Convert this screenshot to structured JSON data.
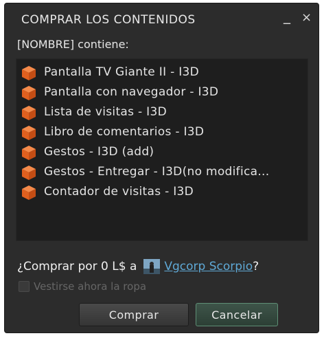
{
  "window": {
    "title": "COMPRAR LOS CONTENIDOS",
    "minimize_glyph": "_",
    "close_glyph": "×"
  },
  "contains_label": "[NOMBRE] contiene:",
  "items": [
    {
      "label": "Pantalla TV Giante II - I3D",
      "icon": "object-cube-icon"
    },
    {
      "label": "Pantalla con navegador - I3D",
      "icon": "object-cube-icon"
    },
    {
      "label": "Lista de visitas - I3D",
      "icon": "object-cube-icon"
    },
    {
      "label": "Libro de comentarios - I3D",
      "icon": "object-cube-icon"
    },
    {
      "label": "Gestos - I3D (add)",
      "icon": "object-cube-icon"
    },
    {
      "label": "Gestos - Entregar  - I3D(no modifica...",
      "icon": "object-cube-icon"
    },
    {
      "label": "Contador de visitas - I3D",
      "icon": "object-cube-icon"
    }
  ],
  "buy_prompt": {
    "prefix": "¿Comprar por 0 L$ a",
    "owner": "Vgcorp Scorpio",
    "suffix": "?"
  },
  "wear_checkbox": {
    "label": "Vestirse ahora la ropa",
    "checked": false,
    "enabled": false
  },
  "buttons": {
    "buy": "Comprar",
    "cancel": "Cancelar"
  },
  "colors": {
    "window_bg": "#2c2c2c",
    "list_bg": "#1e1e1e",
    "link": "#5fa9d6",
    "icon_orange": "#e8662a",
    "cancel_border": "#5f8f76"
  }
}
